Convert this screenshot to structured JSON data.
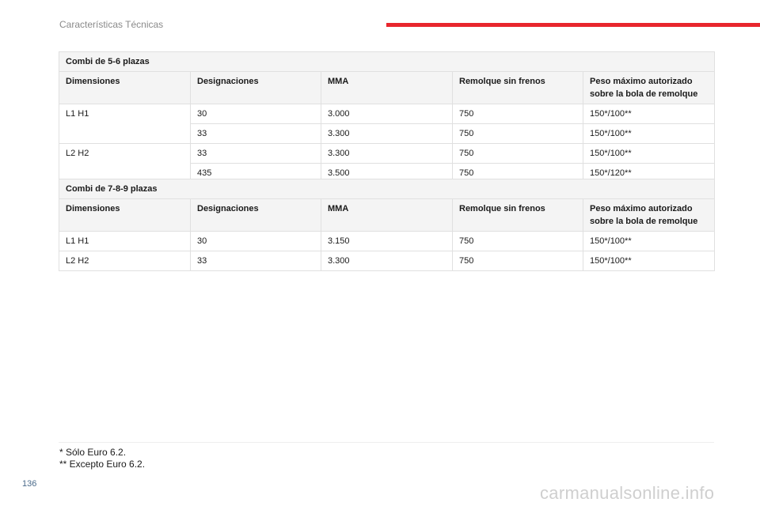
{
  "header": {
    "section_title": "Características Técnicas",
    "accent_color": "#e8262d"
  },
  "tables": [
    {
      "caption": "Combi de 5-6 plazas",
      "columns": [
        "Dimensiones",
        "Designaciones",
        "MMA",
        "Remolque sin frenos",
        "Peso máximo autorizado sobre la bola de remolque"
      ],
      "groups": [
        {
          "dimension": "L1 H1",
          "rows": [
            {
              "designation": "30",
              "mma": "3.000",
              "trailer": "750",
              "max_weight": "150*/100**"
            },
            {
              "designation": "33",
              "mma": "3.300",
              "trailer": "750",
              "max_weight": "150*/100**"
            }
          ]
        },
        {
          "dimension": "L2 H2",
          "rows": [
            {
              "designation": "33",
              "mma": "3.300",
              "trailer": "750",
              "max_weight": "150*/100**"
            },
            {
              "designation": "435",
              "mma": "3.500",
              "trailer": "750",
              "max_weight": "150*/120**"
            }
          ]
        }
      ]
    },
    {
      "caption": "Combi de 7-8-9 plazas",
      "columns": [
        "Dimensiones",
        "Designaciones",
        "MMA",
        "Remolque sin frenos",
        "Peso máximo autorizado sobre la bola de remolque"
      ],
      "groups": [
        {
          "dimension": "L1 H1",
          "rows": [
            {
              "designation": "30",
              "mma": "3.150",
              "trailer": "750",
              "max_weight": "150*/100**"
            }
          ]
        },
        {
          "dimension": "L2 H2",
          "rows": [
            {
              "designation": "33",
              "mma": "3.300",
              "trailer": "750",
              "max_weight": "150*/100**"
            }
          ]
        }
      ]
    }
  ],
  "footnotes": [
    "* Sólo Euro 6.2.",
    "** Excepto Euro 6.2."
  ],
  "page_number": "136",
  "watermark": "carmanualsonline.info"
}
